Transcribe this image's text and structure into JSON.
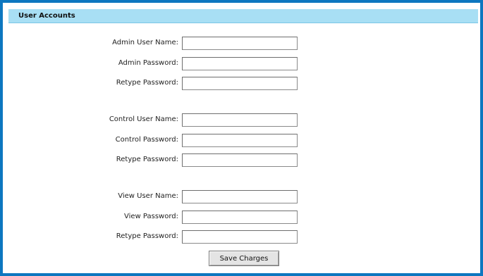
{
  "section": {
    "title": "User Accounts"
  },
  "admin": {
    "user_label": "Admin User Name:",
    "password_label": "Admin Password:",
    "retype_label": "Retype Password:",
    "user_value": "",
    "password_value": "",
    "retype_value": ""
  },
  "control": {
    "user_label": "Control User Name:",
    "password_label": "Control Password:",
    "retype_label": "Retype Password:",
    "user_value": "",
    "password_value": "",
    "retype_value": ""
  },
  "view": {
    "user_label": "View User Name:",
    "password_label": "View Password:",
    "retype_label": "Retype Password:",
    "user_value": "",
    "password_value": "",
    "retype_value": ""
  },
  "actions": {
    "save_label": "Save Charges"
  },
  "colors": {
    "border": "#0d77c0",
    "header": "#a8dff4"
  }
}
